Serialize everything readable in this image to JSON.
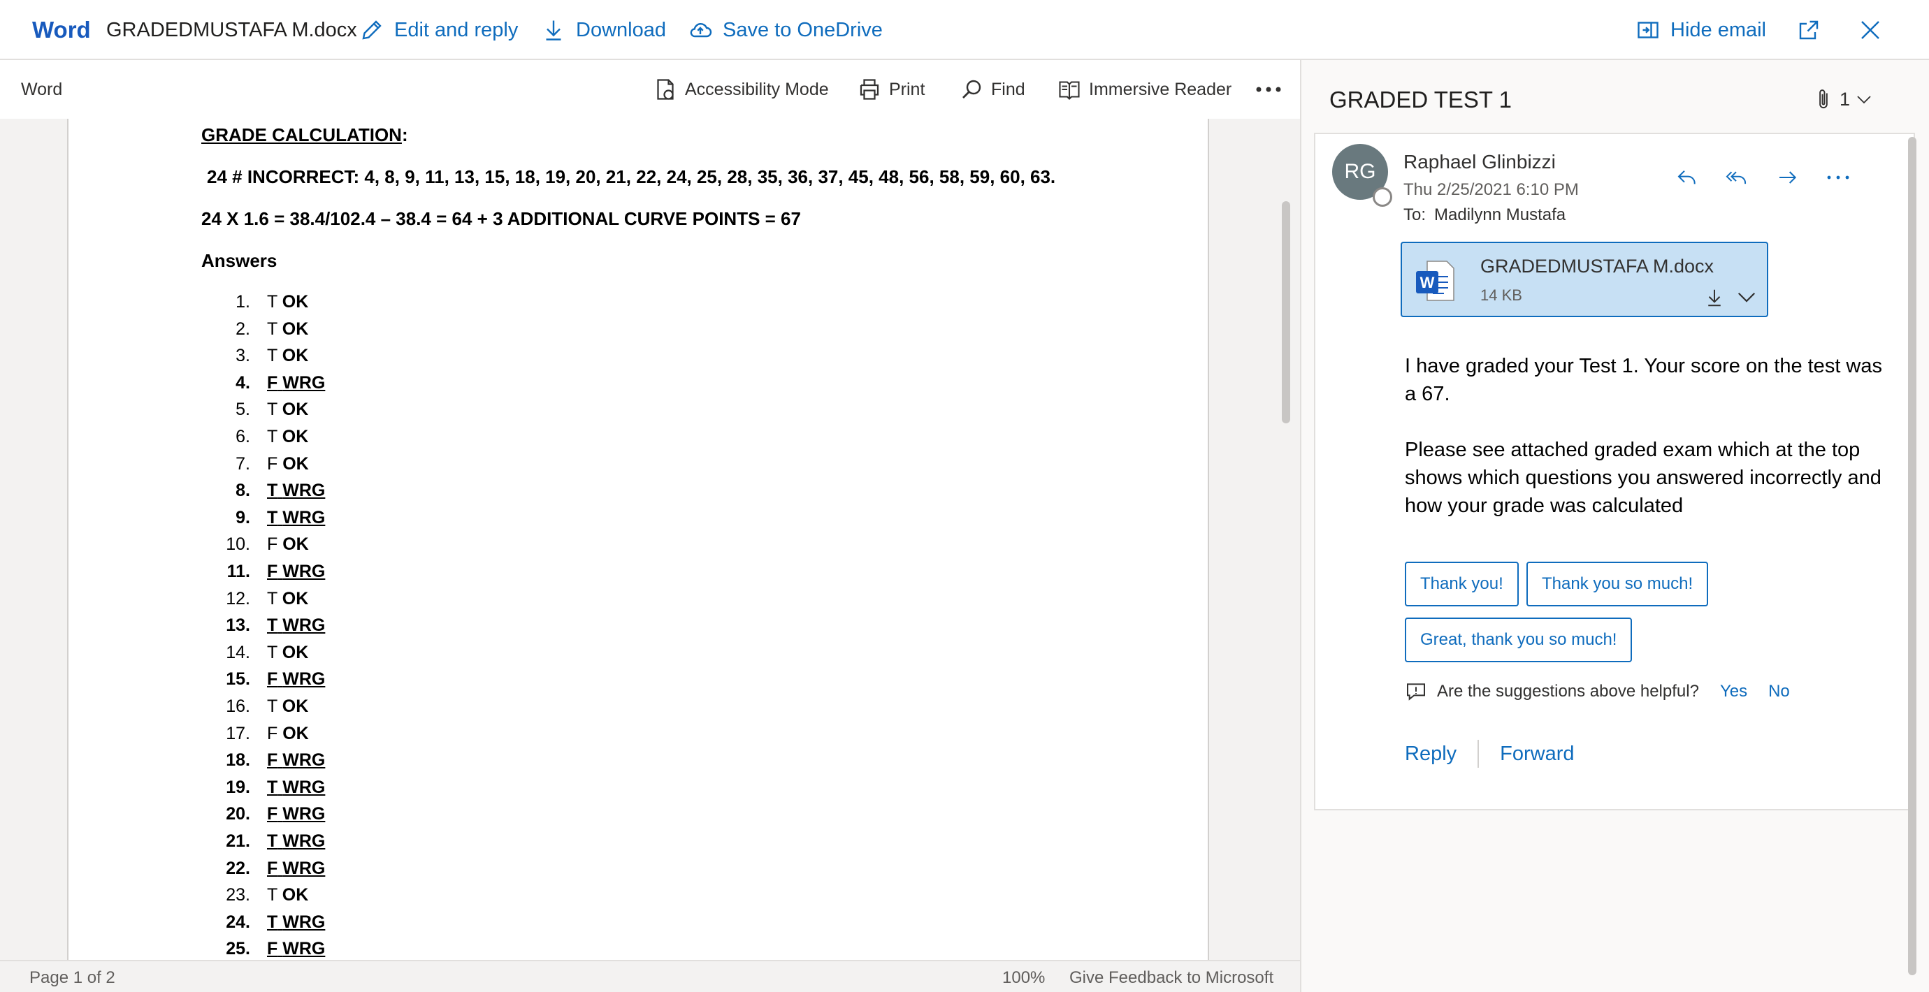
{
  "topbar": {
    "brand": "Word",
    "doc_title": "GRADEDMUSTAFA M.docx",
    "edit_reply": "Edit and reply",
    "download": "Download",
    "save_onedrive": "Save to OneDrive",
    "hide_email": "Hide email",
    "popout_icon": "popout-icon",
    "close_icon": "close-icon"
  },
  "doc_toolbar": {
    "app_label": "Word",
    "accessibility_mode": "Accessibility Mode",
    "print": "Print",
    "find": "Find",
    "immersive_reader": "Immersive Reader",
    "more_icon": "ellipsis-icon"
  },
  "document": {
    "heading": "GRADE CALCULATION",
    "heading_colon": ":",
    "incorrect_line": "24 # INCORRECT:  4, 8, 9, 11, 13, 15, 18, 19, 20, 21, 22, 24, 25, 28, 35, 36, 37, 45, 48, 56, 58, 59, 60, 63.",
    "calc_line": "24 X 1.6 = 38.4/102.4 – 38.4 = 64 + 3 ADDITIONAL CURVE POINTS = 67",
    "answers_heading": "Answers",
    "answers": [
      {
        "num": "1.",
        "letter": "T",
        "mark": "OK",
        "wrong": false
      },
      {
        "num": "2.",
        "letter": "T",
        "mark": "OK",
        "wrong": false
      },
      {
        "num": "3.",
        "letter": "T",
        "mark": "OK",
        "wrong": false
      },
      {
        "num": "4.",
        "letter": "F",
        "mark": "WRG",
        "wrong": true
      },
      {
        "num": "5.",
        "letter": "T",
        "mark": "OK",
        "wrong": false
      },
      {
        "num": "6.",
        "letter": "T",
        "mark": "OK",
        "wrong": false
      },
      {
        "num": "7.",
        "letter": "F",
        "mark": "OK",
        "wrong": false
      },
      {
        "num": "8.",
        "letter": "T",
        "mark": "WRG",
        "wrong": true
      },
      {
        "num": "9.",
        "letter": "T",
        "mark": "WRG",
        "wrong": true
      },
      {
        "num": "10.",
        "letter": "F",
        "mark": "OK",
        "wrong": false
      },
      {
        "num": "11.",
        "letter": "F",
        "mark": "WRG",
        "wrong": true
      },
      {
        "num": "12.",
        "letter": "T",
        "mark": "OK",
        "wrong": false
      },
      {
        "num": "13.",
        "letter": "T",
        "mark": "WRG",
        "wrong": true
      },
      {
        "num": "14.",
        "letter": "T",
        "mark": "OK",
        "wrong": false
      },
      {
        "num": "15.",
        "letter": "F",
        "mark": "WRG",
        "wrong": true
      },
      {
        "num": "16.",
        "letter": "T",
        "mark": "OK",
        "wrong": false
      },
      {
        "num": "17.",
        "letter": "F",
        "mark": "OK",
        "wrong": false
      },
      {
        "num": "18.",
        "letter": "F",
        "mark": "WRG",
        "wrong": true
      },
      {
        "num": "19.",
        "letter": "T",
        "mark": "WRG",
        "wrong": true
      },
      {
        "num": "20.",
        "letter": "F",
        "mark": "WRG",
        "wrong": true
      },
      {
        "num": "21.",
        "letter": "T",
        "mark": "WRG",
        "wrong": true
      },
      {
        "num": "22.",
        "letter": "F",
        "mark": "WRG",
        "wrong": true
      },
      {
        "num": "23.",
        "letter": "T",
        "mark": "OK",
        "wrong": false
      },
      {
        "num": "24.",
        "letter": "T",
        "mark": "WRG",
        "wrong": true
      },
      {
        "num": "25.",
        "letter": "F",
        "mark": "WRG",
        "wrong": true
      }
    ]
  },
  "statusbar": {
    "page_count": "Page 1 of 2",
    "zoom": "100%",
    "feedback": "Give Feedback to Microsoft"
  },
  "email": {
    "subject": "GRADED TEST 1",
    "attachment_count": "1",
    "avatar_initials": "RG",
    "sender": "Raphael Glinbizzi",
    "date": "Thu 2/25/2021 6:10 PM",
    "to_label": "To:",
    "to": "Madilynn Mustafa",
    "attachment": {
      "name": "GRADEDMUSTAFA M.docx",
      "size": "14 KB"
    },
    "body_p1": "I have graded your Test 1.  Your score on the test was a 67.",
    "body_p2": "Please see attached graded exam which at the top shows which questions you answered incorrectly and how your grade was calculated",
    "suggestions": [
      "Thank you!",
      "Thank you so much!",
      "Great, thank you so much!"
    ],
    "helpful_question": "Are the suggestions above helpful?",
    "helpful_yes": "Yes",
    "helpful_no": "No",
    "reply": "Reply",
    "forward": "Forward"
  },
  "colors": {
    "accent": "#0f6cbd",
    "word_brand": "#185abd",
    "attachment_bg": "#c7e0f4"
  }
}
